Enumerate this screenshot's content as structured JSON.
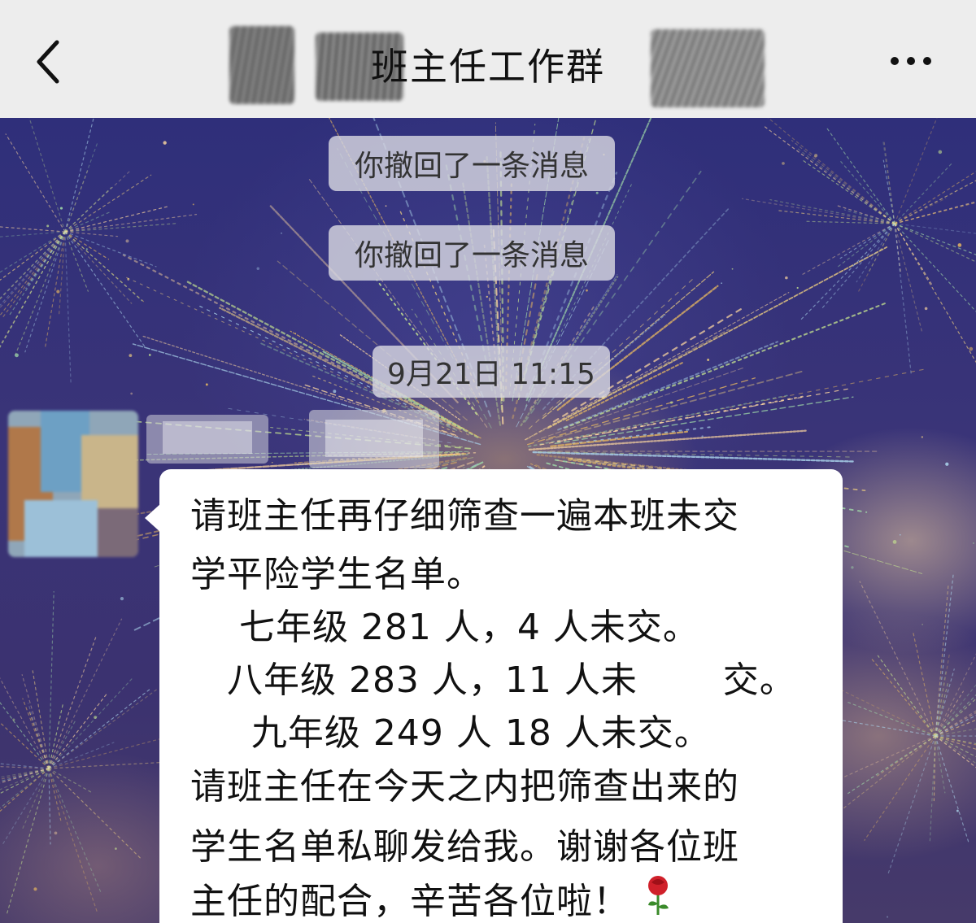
{
  "header": {
    "title": "班主任工作群",
    "back_icon": "chevron-left-icon",
    "more_icon": "more-dots-icon"
  },
  "chat": {
    "notices": [
      "你撤回了一条消息",
      "你撤回了一条消息"
    ],
    "timestamp": "9月21日 11:15",
    "message": {
      "lines": [
        "请班主任再仔细筛查一遍本班未交",
        "学平险学生名单。",
        "    七年级 281 人，4 人未交。",
        "   八年级 283 人，11 人未       交。",
        "     九年级 249 人 18 人未交。",
        "请班主任在今天之内把筛查出来的",
        "学生名单私聊发给我。谢谢各位班",
        "主任的配合，辛苦各位啦！"
      ],
      "emoji": "rose-icon"
    }
  },
  "colors": {
    "header_bg": "#ededed",
    "bubble_bg": "#ffffff",
    "notice_bg": "#d7d7e1",
    "wallpaper": "#2f2f7a"
  }
}
